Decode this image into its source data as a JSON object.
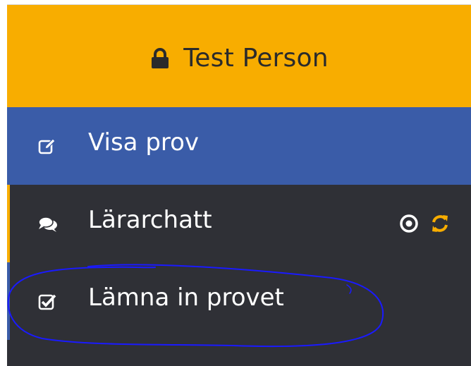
{
  "header": {
    "icon": "lock-icon",
    "user_name": "Test Person",
    "background": "#f8ad00"
  },
  "nav": {
    "items": [
      {
        "label": "Visa prov",
        "icon": "edit-icon",
        "active": true,
        "background": "#3a5ca8"
      },
      {
        "label": "Lärarchatt",
        "icon": "comments-icon",
        "active": false,
        "accent": "#f8ad00",
        "status_icons": [
          "dot-circle-icon",
          "refresh-icon"
        ]
      },
      {
        "label": "Lämna in provet",
        "icon": "checkbox-icon",
        "active": false,
        "accent": "#3a5ca8"
      }
    ]
  },
  "annotation": {
    "type": "hand-drawn-ellipse",
    "color": "#1a1aff"
  },
  "colors": {
    "sidebar_bg": "#2f3036",
    "refresh_icon": "#f8ad00",
    "text": "#ffffff"
  }
}
